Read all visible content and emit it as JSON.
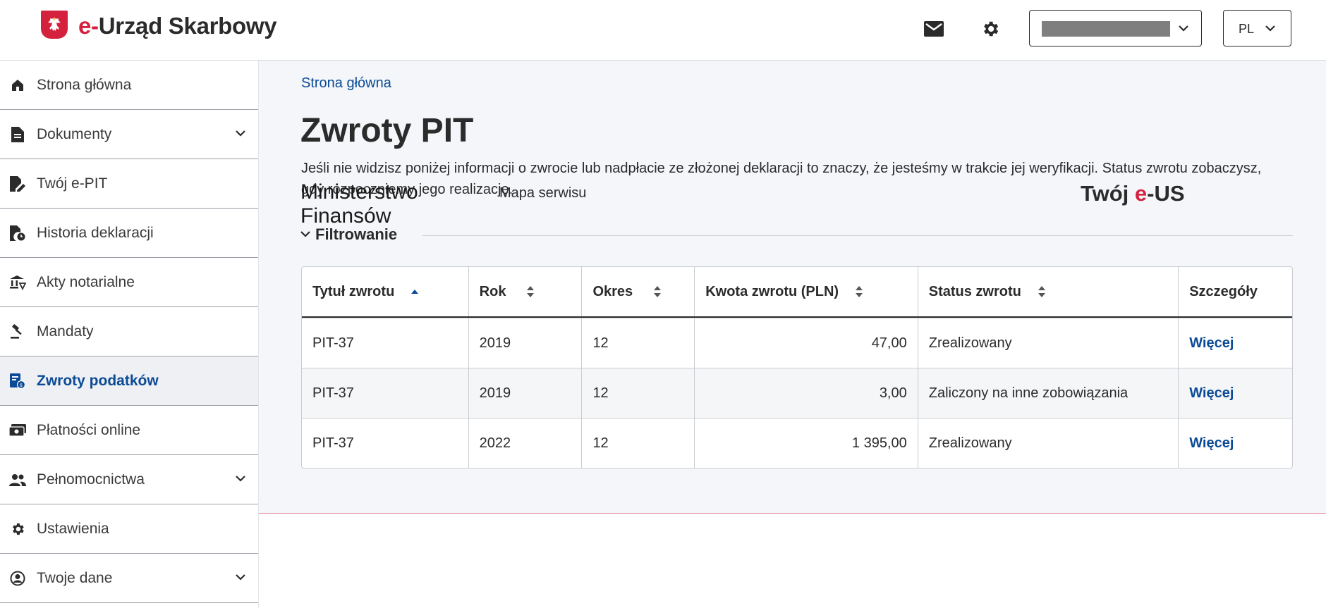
{
  "app": {
    "logo_prefix": "e-",
    "logo_name": "Urząd Skarbowy",
    "language": "PL",
    "icons": {
      "messages": "envelope-icon",
      "settings": "gear-icon"
    }
  },
  "sidebar": {
    "items": [
      {
        "label": "Strona główna",
        "icon": "home-icon"
      },
      {
        "label": "Dokumenty",
        "icon": "document-icon"
      },
      {
        "label": "Twój e-PIT",
        "icon": "edit-document-icon"
      },
      {
        "label": "Historia deklaracji",
        "icon": "document-clock-icon"
      },
      {
        "label": "Akty notarialne",
        "icon": "notary-icon"
      },
      {
        "label": "Mandaty",
        "icon": "gavel-icon"
      },
      {
        "label": "Zwroty podatków",
        "icon": "tax-refund-icon"
      },
      {
        "label": "Płatności online",
        "icon": "money-icon"
      },
      {
        "label": "Pełnomocnictwa",
        "icon": "people-icon"
      },
      {
        "label": "Ustawienia",
        "icon": "gear-icon"
      },
      {
        "label": "Twoje dane",
        "icon": "user-circle-icon"
      }
    ]
  },
  "main": {
    "breadcrumb": "Strona główna",
    "title": "Zwroty PIT",
    "intro": "Jeśli nie widzisz poniżej informacji o zwrocie lub nadpłacie ze złożonej deklaracji to znaczy, że jesteśmy w trakcie jej weryfikacji. Status zwrotu zobaczysz, gdy rozpoczniemy jego realizację.",
    "filter_label": "Filtrowanie",
    "table": {
      "headers": [
        "Tytuł zwrotu",
        "Rok",
        "Okres",
        "Kwota zwrotu (PLN)",
        "Status zwrotu",
        "Szczegóły"
      ],
      "rows": [
        [
          "PIT-37",
          "2019",
          "12",
          "47,00",
          "Zrealizowany",
          "Więcej"
        ],
        [
          "PIT-37",
          "2019",
          "12",
          "3,00",
          "Zaliczony na inne zobowiązania",
          "Więcej"
        ],
        [
          "PIT-37",
          "2022",
          "12",
          "1 395,00",
          "Zrealizowany",
          "Więcej"
        ]
      ]
    }
  },
  "footer": {
    "ministry": "Ministerstwo Finansów",
    "sitemap": "Mapa serwisu",
    "logo_prefix": "Twój ",
    "logo_e": "e",
    "logo_suffix": "-US"
  },
  "colors": {
    "accent": "#d4213d",
    "link": "#0b4a96",
    "background": "#f4f6f9"
  }
}
